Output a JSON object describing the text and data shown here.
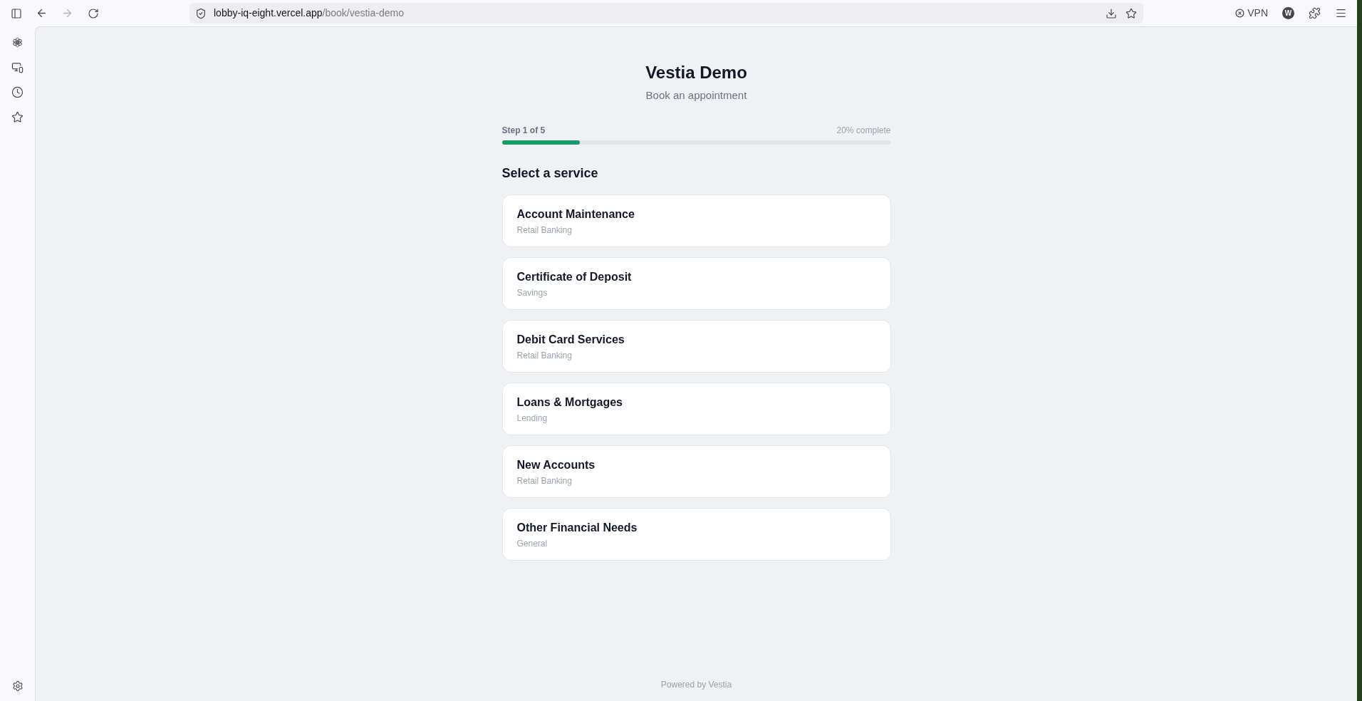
{
  "browser": {
    "back_disabled": false,
    "forward_disabled": true,
    "address": {
      "host": "lobby-iq-eight.vercel.app",
      "path": "/book/vestia-demo"
    },
    "vpn": {
      "label": "VPN"
    },
    "profile": {
      "initial": "W"
    }
  },
  "page": {
    "title": "Vestia Demo",
    "subtitle": "Book an appointment",
    "progress": {
      "step": "Step 1 of 5",
      "percent": "20% complete",
      "level": 0.2
    },
    "section_title": "Select a service",
    "services": [
      {
        "name": "Account Maintenance",
        "category": "Retail Banking"
      },
      {
        "name": "Certificate of Deposit",
        "category": "Savings"
      },
      {
        "name": "Debit Card Services",
        "category": "Retail Banking"
      },
      {
        "name": "Loans & Mortgages",
        "category": "Lending"
      },
      {
        "name": "New Accounts",
        "category": "Retail Banking"
      },
      {
        "name": "Other Financial Needs",
        "category": "General"
      }
    ],
    "footer": "Powered by Vestia"
  }
}
